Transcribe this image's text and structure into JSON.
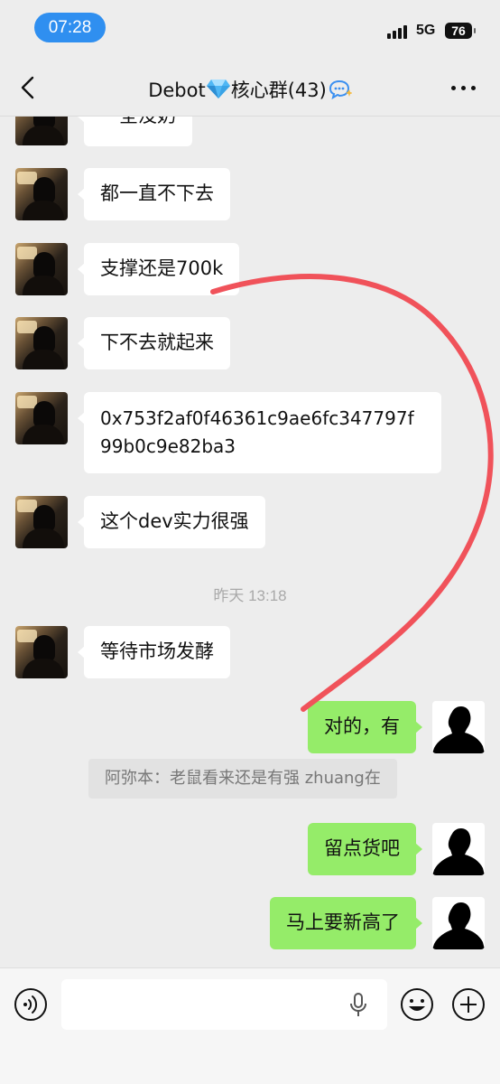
{
  "status_bar": {
    "time": "07:28",
    "network": "5G",
    "battery": "76"
  },
  "header": {
    "title_prefix": "Debot",
    "title_suffix": "核心群",
    "member_count": "(43)"
  },
  "messages": [
    {
      "side": "left",
      "text": "一全没奶"
    },
    {
      "side": "left",
      "text": "都一直不下去"
    },
    {
      "side": "left",
      "text": "支撑还是700k"
    },
    {
      "side": "left",
      "text": "下不去就起来"
    },
    {
      "side": "left",
      "text": "0x753f2af0f46361c9ae6fc347797f99b0c9e82ba3"
    },
    {
      "side": "left",
      "text": "这个dev实力很强"
    },
    {
      "timestamp": "昨天 13:18"
    },
    {
      "side": "left",
      "text": "等待市场发酵"
    },
    {
      "side": "right",
      "text": "对的，有"
    },
    {
      "quote": "阿弥本：老鼠看来还是有强 zhuang在"
    },
    {
      "side": "right",
      "text": "留点货吧"
    },
    {
      "side": "right",
      "text": "马上要新高了"
    }
  ],
  "input": {
    "placeholder": ""
  },
  "colors": {
    "bubble_self": "#95ec69",
    "bubble_other": "#ffffff",
    "annotation": "#f0525a",
    "time_pill": "#2f8ff0"
  },
  "icons": [
    "back-icon",
    "diamond-icon",
    "chat-bubble-icon",
    "more-icon",
    "voice-icon",
    "microphone-icon",
    "emoji-icon",
    "plus-icon"
  ]
}
